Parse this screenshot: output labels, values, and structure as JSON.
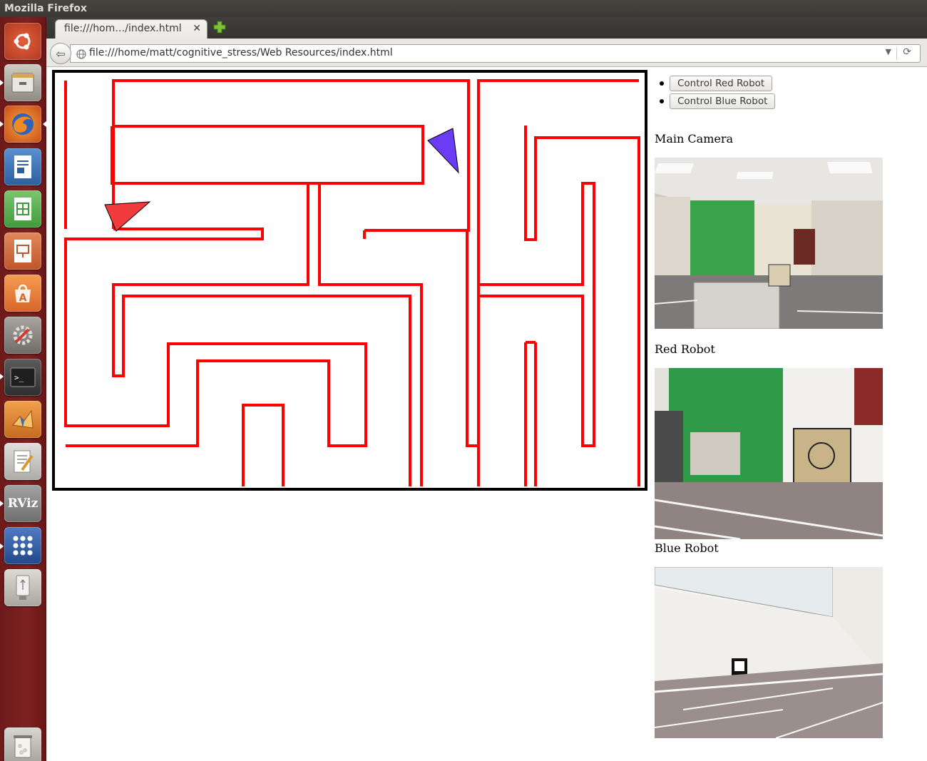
{
  "os": {
    "window_title": "Mozilla Firefox"
  },
  "launcher": {
    "items": [
      {
        "name": "ubuntu-dash-icon",
        "color": "#c84a2c"
      },
      {
        "name": "files-icon",
        "color": "#a7a39a"
      },
      {
        "name": "firefox-icon",
        "color": "#e76b1b"
      },
      {
        "name": "writer-icon",
        "color": "#2b5f9e"
      },
      {
        "name": "calc-icon",
        "color": "#3f9b3c"
      },
      {
        "name": "impress-icon",
        "color": "#c0552b"
      },
      {
        "name": "software-center-icon",
        "color": "#e2792e"
      },
      {
        "name": "system-settings-icon",
        "color": "#8e8a84"
      },
      {
        "name": "terminal-icon",
        "color": "#3a3a3a"
      },
      {
        "name": "matlab-icon",
        "color": "#d9802c"
      },
      {
        "name": "text-editor-icon",
        "color": "#bdbdb8"
      },
      {
        "name": "rviz-icon",
        "color": "#8e8e8e"
      },
      {
        "name": "workspace-switcher-icon",
        "color": "#2f5fa8"
      },
      {
        "name": "usb-drive-icon",
        "color": "#c9c6c0"
      },
      {
        "name": "trash-icon",
        "color": "#bdbab4"
      }
    ],
    "rviz_label": "RViz"
  },
  "browser": {
    "tab_title": "file:///hom…/index.html",
    "url": "file:///home/matt/cognitive_stress/Web Resources/index.html"
  },
  "controls": {
    "red_button": "Control Red Robot",
    "blue_button": "Control Blue Robot"
  },
  "feeds": {
    "main_label": "Main Camera",
    "red_label": "Red Robot",
    "blue_label": "Blue Robot"
  },
  "robots": {
    "red_color": "#f03c3c",
    "blue_color": "#6a3cf5"
  },
  "maze": {
    "wall_color": "#ff0000"
  }
}
